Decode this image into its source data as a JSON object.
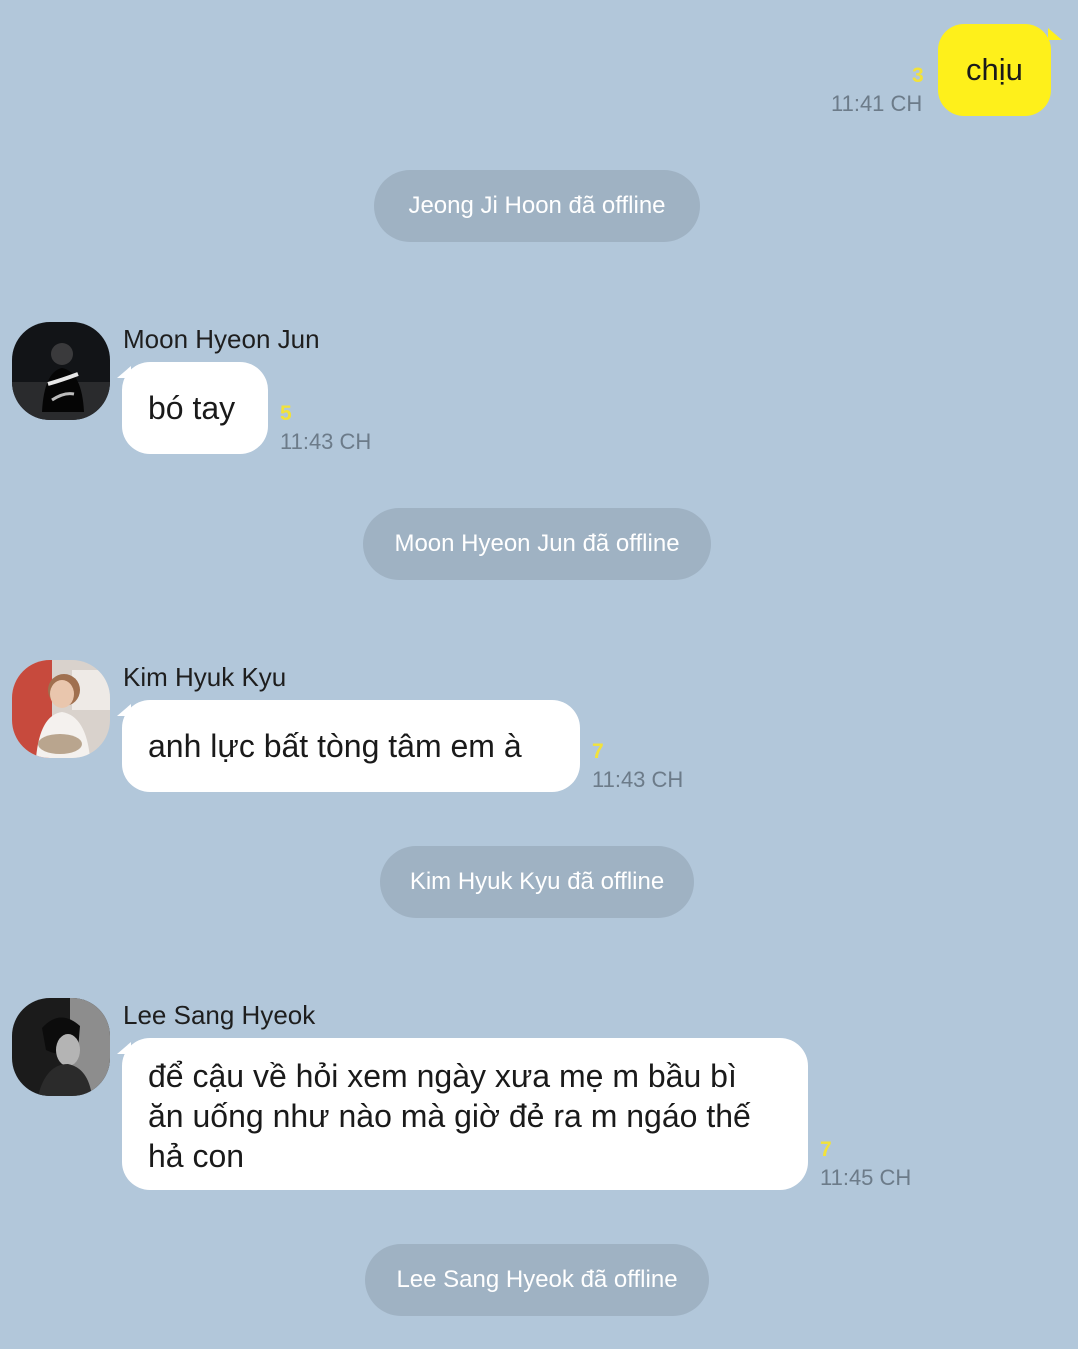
{
  "messages": {
    "outgoing": {
      "text": "chịu",
      "unread": "3",
      "time": "11:41 CH"
    },
    "notices": [
      "Jeong Ji Hoon đã offline",
      "Moon Hyeon Jun đã offline",
      "Kim Hyuk Kyu đã offline",
      "Lee Sang Hyeok đã offline"
    ],
    "incoming": [
      {
        "sender": "Moon Hyeon Jun",
        "text": "bó tay",
        "unread": "5",
        "time": "11:43 CH"
      },
      {
        "sender": "Kim Hyuk Kyu",
        "text": "anh lực bất tòng tâm em à",
        "unread": "7",
        "time": "11:43 CH"
      },
      {
        "sender": "Lee Sang Hyeok",
        "lines": [
          "để cậu về hỏi xem ngày xưa mẹ m bầu bì",
          "ăn uống như nào mà giờ đẻ ra m ngáo thế",
          "hả con"
        ],
        "unread": "7",
        "time": "11:45 CH"
      }
    ]
  },
  "colors": {
    "background": "#b2c7da",
    "outgoing_bubble": "#fef01b",
    "incoming_bubble": "#ffffff",
    "notice_bubble": "#9fb2c3",
    "unread_count": "#f2e23a"
  }
}
